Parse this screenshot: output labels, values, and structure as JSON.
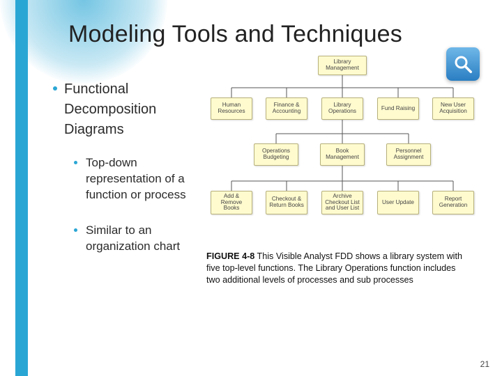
{
  "title": "Modeling Tools and Techniques",
  "bullets": {
    "level1": "Functional Decomposition Diagrams",
    "level2": [
      "Top-down representation of a function or process",
      "Similar to an organization chart"
    ]
  },
  "figure": {
    "caption_label": "FIGURE 4-8",
    "caption_text": " This Visible Analyst FDD shows a library system with five top-level functions. The Library Operations function includes two additional levels of processes and sub processes",
    "icon_name": "magnifier-icon",
    "nodes": {
      "root": "Library Management",
      "l1": [
        "Human Resources",
        "Finance & Accounting",
        "Library Operations",
        "Fund Raising",
        "New User Acquisition"
      ],
      "l2": [
        "Operations Budgeting",
        "Book Management",
        "Personnel Assignment"
      ],
      "l3": [
        "Add & Remove Books",
        "Checkout & Return Books",
        "Archive Checkout List and User List",
        "User Update",
        "Report Generation"
      ]
    }
  },
  "page_number": "21"
}
